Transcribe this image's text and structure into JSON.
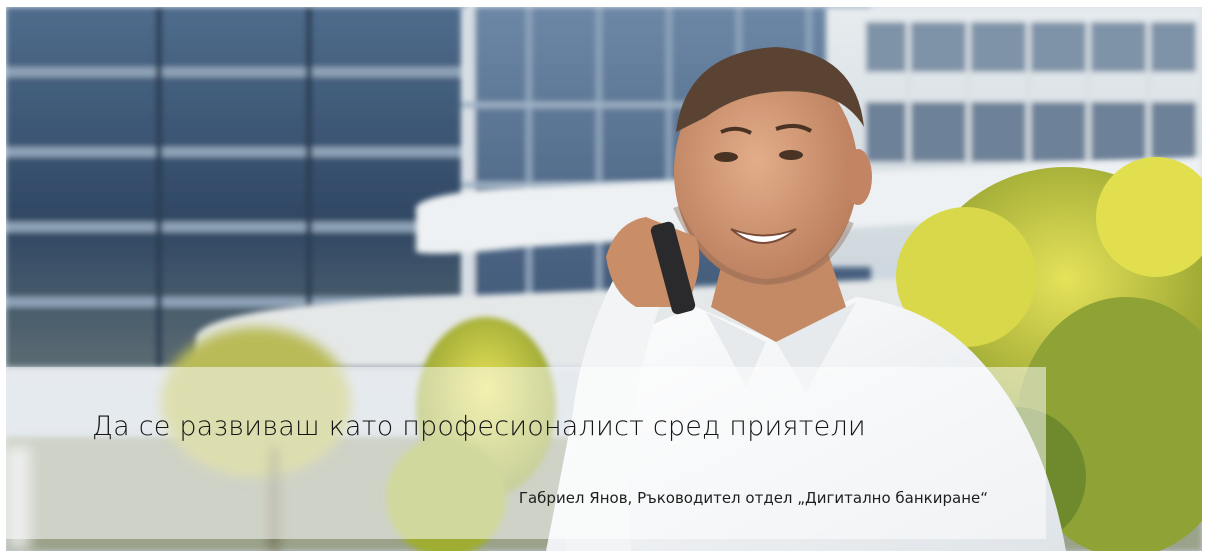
{
  "hero": {
    "image_description": "",
    "quote": "Да се развиваш като професионалист сред приятели",
    "attribution": "Габриел Янов, Ръководител отдел „Дигитално банкиране“"
  },
  "colors": {
    "sky": "#c9d6e2",
    "building_glass": "#3f5b7a",
    "foliage": "#c9cf3c",
    "shirt": "#f6f6f4",
    "skin": "#d39a78"
  }
}
